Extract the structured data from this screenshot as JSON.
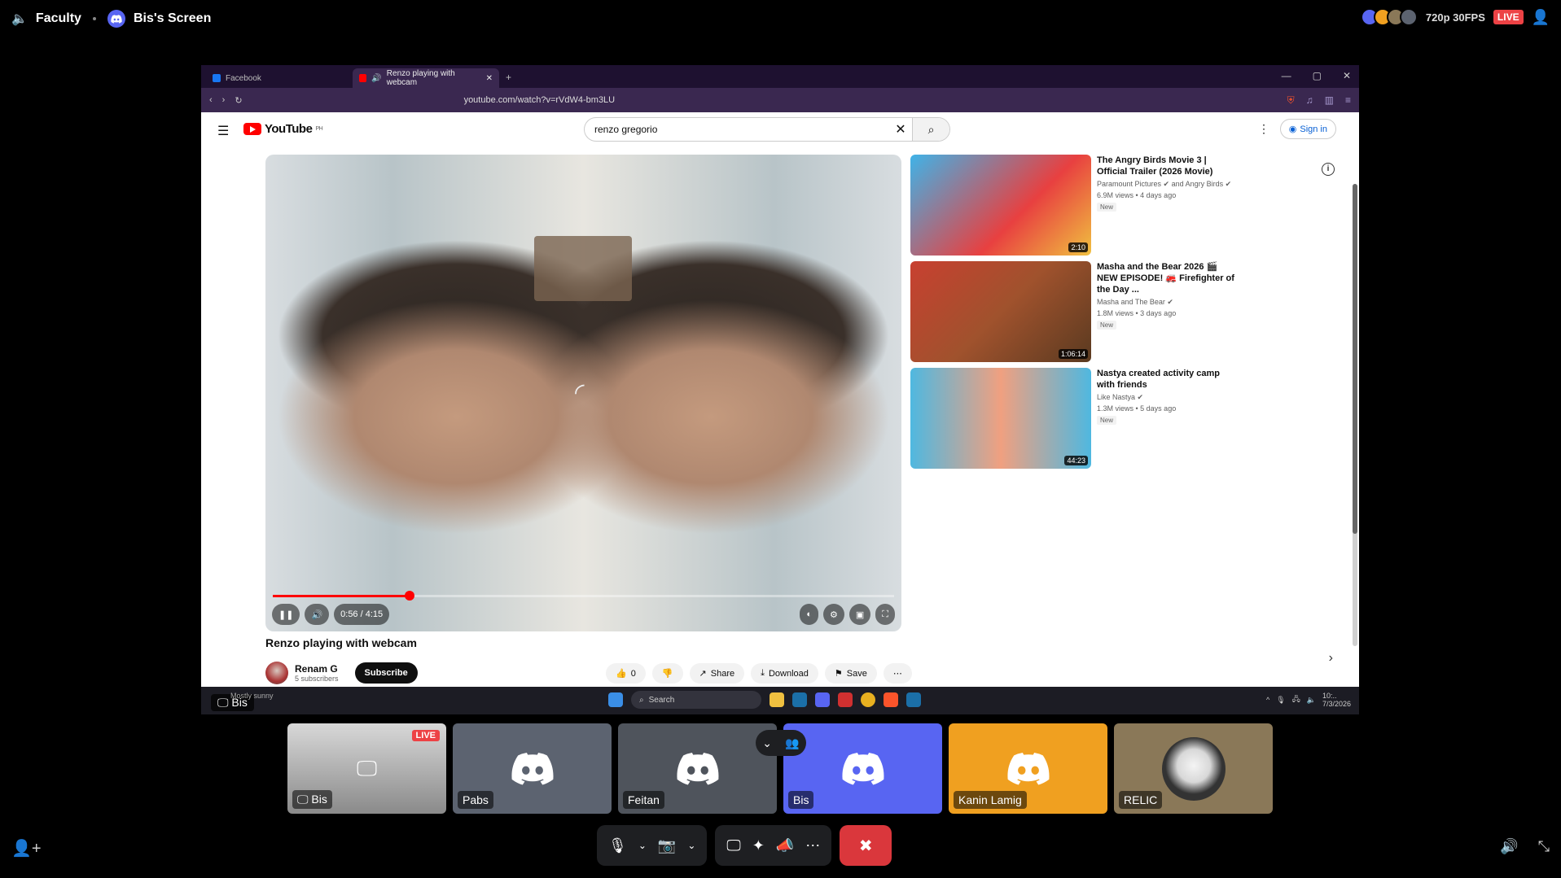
{
  "discord": {
    "channel": "Faculty",
    "screen_title": "Bis's Screen",
    "stream_quality": "720p 30FPS",
    "live_label": "LIVE"
  },
  "browser": {
    "tabs": [
      {
        "label": "Facebook"
      },
      {
        "label": "Renzo playing with webcam"
      }
    ],
    "url": "youtube.com/watch?v=rVdW4-bm3LU"
  },
  "youtube": {
    "logo_text": "YouTube",
    "region": "PH",
    "search_value": "renzo gregorio",
    "signin_label": "Sign in",
    "video": {
      "title": "Renzo playing with webcam",
      "time": "0:56 / 4:15",
      "progress": 0.22,
      "channel": "Renam G",
      "subscribers": "5 subscribers",
      "subscribe_label": "Subscribe",
      "likes": "0",
      "share_label": "Share",
      "download_label": "Download",
      "save_label": "Save"
    },
    "recommendations": [
      {
        "title": "The Angry Birds Movie 3 | Official Trailer (2026 Movie)",
        "channel": "Paramount Pictures ✔ and Angry Birds ✔",
        "views": "6.9M views • 4 days ago",
        "badge": "New",
        "duration": "2:10",
        "thumb_color": "#3fb3e8"
      },
      {
        "title": "Masha and the Bear 2026 🎬 NEW EPISODE! 🚒 Firefighter of the Day ...",
        "channel": "Masha and The Bear ✔",
        "views": "1.8M views • 3 days ago",
        "badge": "New",
        "duration": "1:06:14",
        "thumb_color": "#a0522d"
      },
      {
        "title": "Nastya created activity camp with friends",
        "channel": "Like Nastya ✔",
        "views": "1.3M views • 5 days ago",
        "badge": "New",
        "duration": "44:23",
        "thumb_color": "#4fb8e0"
      }
    ]
  },
  "taskbar": {
    "weather": "Mostly sunny",
    "search_placeholder": "Search",
    "time": "10:..",
    "date": "7/3/2026"
  },
  "share_overlay_label": "Bis",
  "participants": [
    {
      "name": "Bis",
      "bg": "#2b2d31",
      "type": "stream",
      "live": "LIVE"
    },
    {
      "name": "Pabs",
      "bg": "#5c6370",
      "type": "discord"
    },
    {
      "name": "Feitan",
      "bg": "#4f545c",
      "type": "discord"
    },
    {
      "name": "Bis",
      "bg": "#5865f2",
      "type": "discord"
    },
    {
      "name": "Kanin Lamig",
      "bg": "#f0a020",
      "type": "discord"
    },
    {
      "name": "RELIC",
      "bg": "#8a7858",
      "type": "avatar"
    }
  ],
  "colors": {
    "discord_blurple": "#5865f2",
    "live_red": "#ed4245",
    "yt_red": "#ff0000",
    "leave_red": "#da373c"
  }
}
